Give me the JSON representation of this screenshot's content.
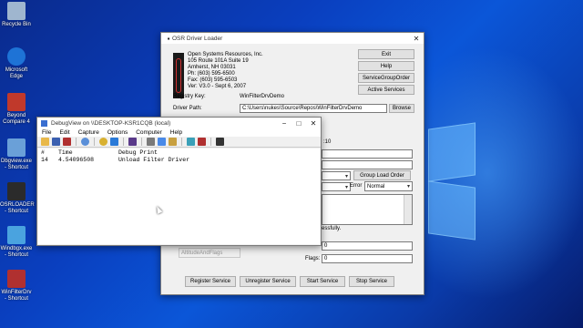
{
  "desktop": {
    "icons": [
      {
        "label": "Recycle Bin",
        "color": "#9fb6cf"
      },
      {
        "label": "Microsoft Edge",
        "color": "#1e73d6"
      },
      {
        "label": "Beyond Compare 4",
        "color": "#c0392b"
      },
      {
        "label": "Dbgview.exe - Shortcut",
        "color": "#6aa0d8"
      },
      {
        "label": "OSRLOADER - Shortcut",
        "color": "#2b2b2b"
      },
      {
        "label": "Windbgx.exe - Shortcut",
        "color": "#4aa3df"
      },
      {
        "label": "WinFilterDrv - Shortcut",
        "color": "#b03030"
      }
    ]
  },
  "osr": {
    "title": "OSR Driver Loader",
    "company": {
      "line1": "Open Systems Resources, Inc.",
      "line2": "105 Route 101A Suite 19",
      "line3": "Amherst, NH 03031",
      "line4": "Ph:  (603) 595-6500",
      "line5": "Fax: (603) 595-6503",
      "line6": "Ver: V3.0  -  Sept 6, 2007"
    },
    "buttons": {
      "exit": "Exit",
      "help": "Help",
      "service_group_order": "ServiceGroupOrder",
      "active_services": "Active Services",
      "browse": "Browse",
      "group_load_order": "Group Load Order",
      "register": "Register Service",
      "unregister": "Unregister Service",
      "start": "Start Service",
      "stop": "Stop Service"
    },
    "registry_key_label": "Registry Key:",
    "registry_key_value": "WinFilterDrvDemo",
    "driver_path_label": "Driver Path:",
    "driver_path_value": "C:\\Users\\nukes\\Source\\Repos\\WinFilterDrvDemo",
    "partial_value": ":10",
    "error_label": "Error",
    "error_value": "Normal",
    "status_text": "essfully.",
    "altitude_placeholder": "AltitudeAndFlags",
    "altitude_value": "0",
    "flags_label": "Flags:",
    "flags_value": "0"
  },
  "debugview": {
    "title": "DebugView on \\\\DESKTOP-KSR1CQB (local)",
    "menu": [
      "File",
      "Edit",
      "Capture",
      "Options",
      "Computer",
      "Help"
    ],
    "toolbar_icons": [
      "open-icon",
      "save-icon",
      "save-as-icon",
      "find-icon",
      "capture-icon",
      "arrow-icon",
      "clear-icon",
      "filter-icon",
      "highlight-icon",
      "history-icon",
      "connect-icon",
      "pin-icon",
      "binoculars-icon"
    ],
    "columns": [
      "#",
      "Time",
      "Debug Print"
    ],
    "rows": [
      {
        "num": "14",
        "time": "4.54096508",
        "text": "Unload Filter Driver"
      }
    ]
  }
}
